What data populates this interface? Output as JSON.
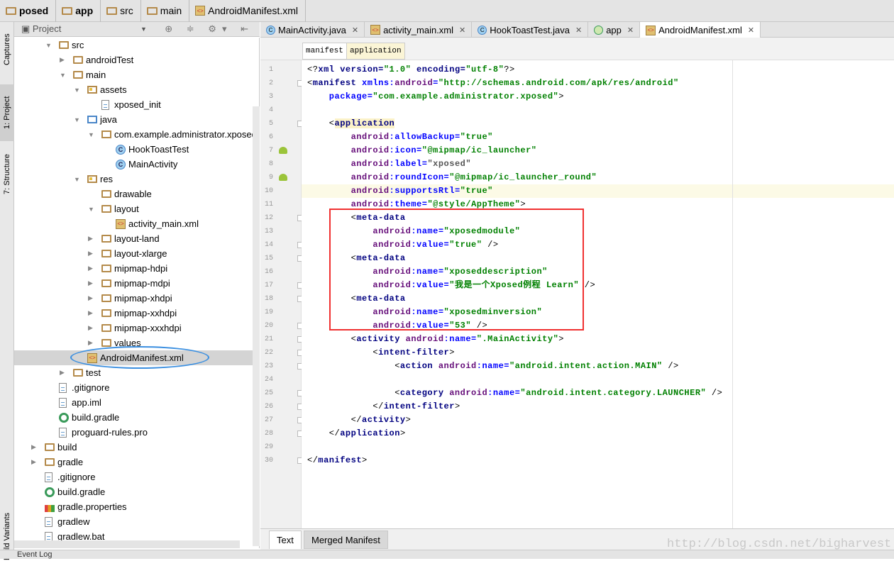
{
  "breadcrumb": [
    {
      "label": "posed",
      "bold": true,
      "icon": "module-folder-icon"
    },
    {
      "label": "app",
      "bold": true,
      "icon": "module-folder-icon"
    },
    {
      "label": "src",
      "icon": "folder-icon"
    },
    {
      "label": "main",
      "icon": "folder-icon"
    },
    {
      "label": "AndroidManifest.xml",
      "icon": "manifest-file-icon"
    }
  ],
  "left_strip": {
    "captures": "Captures",
    "project": "1: Project",
    "structure": "7: Structure",
    "build_variants": "Build Variants"
  },
  "project_panel": {
    "title": "Project",
    "tools": "⊕ ≑ ⚙▾ ⇤"
  },
  "tree": [
    {
      "d": 1,
      "a": "open",
      "i": "folder",
      "l": "src"
    },
    {
      "d": 2,
      "a": "closed",
      "i": "folder",
      "l": "androidTest"
    },
    {
      "d": 2,
      "a": "open",
      "i": "folder",
      "l": "main"
    },
    {
      "d": 3,
      "a": "open",
      "i": "res",
      "l": "assets"
    },
    {
      "d": 4,
      "a": "",
      "i": "file",
      "l": "xposed_init"
    },
    {
      "d": 3,
      "a": "open",
      "i": "javafolder",
      "l": "java"
    },
    {
      "d": 4,
      "a": "open",
      "i": "pkg",
      "l": "com.example.administrator.xposed"
    },
    {
      "d": 5,
      "a": "",
      "i": "class",
      "l": "HookToastTest"
    },
    {
      "d": 5,
      "a": "",
      "i": "class",
      "l": "MainActivity"
    },
    {
      "d": 3,
      "a": "open",
      "i": "res",
      "l": "res"
    },
    {
      "d": 4,
      "a": "",
      "i": "folder",
      "l": "drawable"
    },
    {
      "d": 4,
      "a": "open",
      "i": "folder",
      "l": "layout"
    },
    {
      "d": 5,
      "a": "",
      "i": "xml",
      "l": "activity_main.xml"
    },
    {
      "d": 4,
      "a": "closed",
      "i": "folder",
      "l": "layout-land"
    },
    {
      "d": 4,
      "a": "closed",
      "i": "folder",
      "l": "layout-xlarge"
    },
    {
      "d": 4,
      "a": "closed",
      "i": "folder",
      "l": "mipmap-hdpi"
    },
    {
      "d": 4,
      "a": "closed",
      "i": "folder",
      "l": "mipmap-mdpi"
    },
    {
      "d": 4,
      "a": "closed",
      "i": "folder",
      "l": "mipmap-xhdpi"
    },
    {
      "d": 4,
      "a": "closed",
      "i": "folder",
      "l": "mipmap-xxhdpi"
    },
    {
      "d": 4,
      "a": "closed",
      "i": "folder",
      "l": "mipmap-xxxhdpi"
    },
    {
      "d": 4,
      "a": "closed",
      "i": "folder",
      "l": "values"
    },
    {
      "d": 3,
      "a": "",
      "i": "xml",
      "l": "AndroidManifest.xml",
      "sel": true
    },
    {
      "d": 2,
      "a": "closed",
      "i": "folder",
      "l": "test"
    },
    {
      "d": 1,
      "a": "",
      "i": "file",
      "l": ".gitignore"
    },
    {
      "d": 1,
      "a": "",
      "i": "file",
      "l": "app.iml"
    },
    {
      "d": 1,
      "a": "",
      "i": "gradle",
      "l": "build.gradle"
    },
    {
      "d": 1,
      "a": "",
      "i": "file",
      "l": "proguard-rules.pro"
    },
    {
      "d": 0,
      "a": "closed",
      "i": "folder",
      "l": "build"
    },
    {
      "d": 0,
      "a": "closed",
      "i": "folder",
      "l": "gradle"
    },
    {
      "d": 0,
      "a": "",
      "i": "file",
      "l": ".gitignore"
    },
    {
      "d": 0,
      "a": "",
      "i": "gradle",
      "l": "build.gradle"
    },
    {
      "d": 0,
      "a": "",
      "i": "props",
      "l": "gradle.properties"
    },
    {
      "d": 0,
      "a": "",
      "i": "file",
      "l": "gradlew"
    },
    {
      "d": 0,
      "a": "",
      "i": "file",
      "l": "gradlew.bat"
    }
  ],
  "editor_tabs": [
    {
      "label": "MainActivity.java",
      "icon": "class"
    },
    {
      "label": "activity_main.xml",
      "icon": "xml"
    },
    {
      "label": "HookToastTest.java",
      "icon": "class"
    },
    {
      "label": "app",
      "icon": "android"
    },
    {
      "label": "AndroidManifest.xml",
      "icon": "xml",
      "active": true
    }
  ],
  "breadcrumb_tags": [
    {
      "label": "manifest"
    },
    {
      "label": "application",
      "active": true
    }
  ],
  "code": {
    "current_line": 10,
    "lines": [
      [
        [
          "<?",
          "p"
        ],
        [
          "xml version=",
          "tag"
        ],
        [
          "\"1.0\"",
          "val"
        ],
        [
          " encoding=",
          "tag"
        ],
        [
          "\"utf-8\"",
          "val"
        ],
        [
          "?>",
          "p"
        ]
      ],
      [
        [
          "<",
          "p"
        ],
        [
          "manifest ",
          "tag"
        ],
        [
          "xmlns:",
          "attr"
        ],
        [
          "android",
          "ns"
        ],
        [
          "=",
          "attr"
        ],
        [
          "\"http://schemas.android.com/apk/res/android\"",
          "val"
        ]
      ],
      [
        [
          "    package=",
          "attr"
        ],
        [
          "\"com.example.administrator.xposed\"",
          "val"
        ],
        [
          ">",
          "p"
        ]
      ],
      [],
      [
        [
          "    <",
          "p"
        ],
        [
          "application",
          "tag hl"
        ]
      ],
      [
        [
          "        android",
          "ns"
        ],
        [
          ":allowBackup=",
          "attr"
        ],
        [
          "\"true\"",
          "val"
        ]
      ],
      [
        [
          "        android",
          "ns"
        ],
        [
          ":icon=",
          "attr"
        ],
        [
          "\"@mipmap/ic_launcher\"",
          "val"
        ]
      ],
      [
        [
          "        android",
          "ns"
        ],
        [
          ":label=",
          "attr"
        ],
        [
          "\"xposed\"",
          "dim"
        ]
      ],
      [
        [
          "        android",
          "ns"
        ],
        [
          ":roundIcon=",
          "attr"
        ],
        [
          "\"@mipmap/ic_launcher_round\"",
          "val"
        ]
      ],
      [
        [
          "        android",
          "ns"
        ],
        [
          ":supportsRtl=",
          "attr"
        ],
        [
          "\"true\"",
          "val"
        ]
      ],
      [
        [
          "        android",
          "ns"
        ],
        [
          ":theme=",
          "attr"
        ],
        [
          "\"@style/AppTheme\"",
          "val"
        ],
        [
          ">",
          "p"
        ]
      ],
      [
        [
          "        <",
          "p"
        ],
        [
          "meta-data",
          "tag"
        ]
      ],
      [
        [
          "            android",
          "ns"
        ],
        [
          ":name=",
          "attr"
        ],
        [
          "\"xposedmodule\"",
          "val"
        ]
      ],
      [
        [
          "            android",
          "ns"
        ],
        [
          ":value=",
          "attr"
        ],
        [
          "\"true\"",
          "val"
        ],
        [
          " />",
          "p"
        ]
      ],
      [
        [
          "        <",
          "p"
        ],
        [
          "meta-data",
          "tag"
        ]
      ],
      [
        [
          "            android",
          "ns"
        ],
        [
          ":name=",
          "attr"
        ],
        [
          "\"xposeddescription\"",
          "val"
        ]
      ],
      [
        [
          "            android",
          "ns"
        ],
        [
          ":value=",
          "attr"
        ],
        [
          "\"我是一个Xposed例程 Learn\"",
          "val"
        ],
        [
          " />",
          "p"
        ]
      ],
      [
        [
          "        <",
          "p"
        ],
        [
          "meta-data",
          "tag"
        ]
      ],
      [
        [
          "            android",
          "ns"
        ],
        [
          ":name=",
          "attr"
        ],
        [
          "\"xposedminversion\"",
          "val"
        ]
      ],
      [
        [
          "            android",
          "ns"
        ],
        [
          ":value=",
          "attr"
        ],
        [
          "\"53\"",
          "val"
        ],
        [
          " />",
          "p"
        ]
      ],
      [
        [
          "        <",
          "p"
        ],
        [
          "activity ",
          "tag"
        ],
        [
          "android",
          "ns"
        ],
        [
          ":name=",
          "attr"
        ],
        [
          "\".MainActivity\"",
          "val"
        ],
        [
          ">",
          "p"
        ]
      ],
      [
        [
          "            <",
          "p"
        ],
        [
          "intent-filter",
          "tag"
        ],
        [
          ">",
          "p"
        ]
      ],
      [
        [
          "                <",
          "p"
        ],
        [
          "action ",
          "tag"
        ],
        [
          "android",
          "ns"
        ],
        [
          ":name=",
          "attr"
        ],
        [
          "\"android.intent.action.MAIN\"",
          "val"
        ],
        [
          " />",
          "p"
        ]
      ],
      [],
      [
        [
          "                <",
          "p"
        ],
        [
          "category ",
          "tag"
        ],
        [
          "android",
          "ns"
        ],
        [
          ":name=",
          "attr"
        ],
        [
          "\"android.intent.category.LAUNCHER\"",
          "val"
        ],
        [
          " />",
          "p"
        ]
      ],
      [
        [
          "            </",
          "p"
        ],
        [
          "intent-filter",
          "tag"
        ],
        [
          ">",
          "p"
        ]
      ],
      [
        [
          "        </",
          "p"
        ],
        [
          "activity",
          "tag"
        ],
        [
          ">",
          "p"
        ]
      ],
      [
        [
          "    </",
          "p"
        ],
        [
          "application",
          "tag"
        ],
        [
          ">",
          "p"
        ]
      ],
      [],
      [
        [
          "</",
          "p"
        ],
        [
          "manifest",
          "tag"
        ],
        [
          ">",
          "p"
        ]
      ]
    ]
  },
  "bottom_tabs": [
    {
      "label": "Text",
      "active": true
    },
    {
      "label": "Merged Manifest"
    }
  ],
  "status_bar": {
    "event_log": "Event Log"
  },
  "watermark": "http://blog.csdn.net/bigharvest",
  "colors": {
    "highlight_box": "#f03030",
    "annotation_ellipse": "#3b8fe0"
  }
}
